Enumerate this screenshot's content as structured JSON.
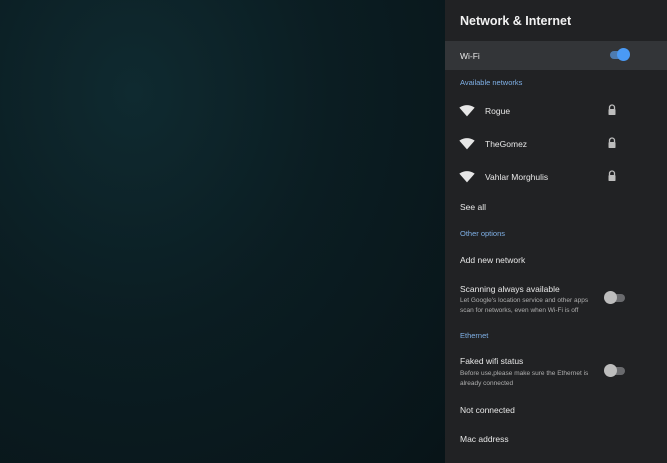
{
  "panel": {
    "title": "Network & Internet",
    "wifi": {
      "label": "Wi-Fi",
      "enabled": true
    },
    "available_header": "Available networks",
    "networks": [
      {
        "name": "Rogue",
        "secured": true
      },
      {
        "name": "TheGomez",
        "secured": true
      },
      {
        "name": "Vahlar Morghulis",
        "secured": true
      }
    ],
    "see_all": "See all",
    "other_header": "Other options",
    "add_network": "Add new network",
    "scanning": {
      "label": "Scanning always available",
      "description": "Let Google's location service and other apps scan for networks, even when Wi-Fi is off",
      "enabled": false
    },
    "ethernet_header": "Ethernet",
    "faked_wifi": {
      "label": "Faked wifi status",
      "description": "Before use,please make sure the Ethernet is already connected",
      "enabled": false
    },
    "connection_status": "Not connected",
    "mac_address": "Mac address"
  },
  "colors": {
    "panel_bg": "#212224",
    "accent": "#4a9af5",
    "section_header": "#7fb0e6"
  }
}
